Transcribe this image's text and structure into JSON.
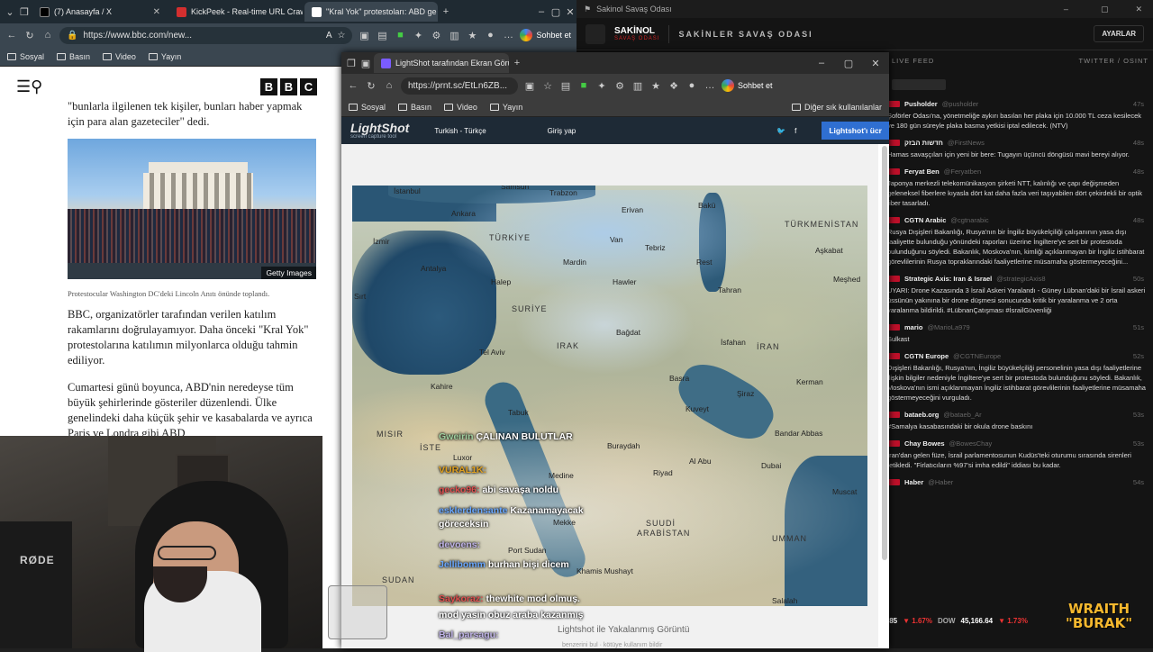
{
  "left_browser": {
    "tabs": [
      {
        "label": "(7) Anasayfa / X",
        "color": "#000000"
      },
      {
        "label": "KickPeek - Real-time URL Crawl",
        "color": "#d32f2f"
      },
      {
        "label": "\"Kral Yok\" protestoları: ABD ge",
        "color": "#111111"
      }
    ],
    "url": "https://www.bbc.com/new...",
    "sohbet": "Sohbet et",
    "bookmarks": [
      "Sosyal",
      "Basın",
      "Video",
      "Yayın"
    ]
  },
  "bbc": {
    "para0": "\"bunlarla ilgilenen tek kişiler, bunları haber yapmak için para alan gazeteciler\" dedi.",
    "image_credit": "Getty Images",
    "caption": "Protestocular Washington DC'deki Lincoln Anıtı önünde toplandı.",
    "para1": "BBC, organizatörler tarafından verilen katılım rakamlarını doğrulayamıyor. Daha önceki \"Kral Yok\" protestolarına katılımın milyonlarca olduğu tahmin ediliyor.",
    "para2": "Cumartesi günü boyunca, ABD'nin neredeyse tüm büyük şehirlerinde gösteriler düzenlendi. Ülke genelindeki daha küçük şehir ve kasabalarda ve ayrıca Paris ve Londra gibi ABD"
  },
  "cam": {
    "mic": "RØDE"
  },
  "right_app": {
    "window_title": "Sakinol Savaş Odası",
    "logo": "SAKİNOL",
    "logo_sub": "SAVAŞ ODASI",
    "heading": "SAKİNLER SAVAŞ ODASI",
    "settings": "AYARLAR",
    "live_feed": "LIVE FEED",
    "sources": "TWITTER / OSINT",
    "feed": [
      {
        "who": "Pusholder",
        "handle": "@pusholder",
        "t": "47s",
        "text": "Şoförler Odası'na, yönetmeliğe aykırı basılan her plaka için 10.000 TL ceza kesilecek ve 180 gün süreyle plaka basma yetkisi iptal edilecek. (NTV)"
      },
      {
        "who": "חדשות הבזק",
        "handle": "@FirstNews",
        "t": "48s",
        "text": "Hamas savaşçıları için yeni bir bere: Tugayın üçüncü döngüsü mavi bereyi alıyor."
      },
      {
        "who": "Feryat Ben",
        "handle": "@Feryatben",
        "t": "48s",
        "text": "Japonya merkezli telekomünikasyon şirketi NTT, kalınlığı ve çapı değişmeden geleneksel fiberlere kıyasla dört kat daha fazla veri taşıyabilen dört çekirdekli bir optik fiber tasarladı."
      },
      {
        "who": "CGTN Arabic",
        "handle": "@cgtnarabic",
        "t": "48s",
        "text": "Rusya Dışişleri Bakanlığı, Rusya'nın bir İngiliz büyükelçiliği çalışanının yasa dışı faaliyette bulunduğu yönündeki raporları üzerine İngiltere'ye sert bir protestoda bulunduğunu söyledi. Bakanlık, Moskova'nın, kimliği açıklanmayan bir İngiliz istihbarat görevlilerinin Rusya topraklarındaki faaliyetlerine müsamaha göstermeyeceğini..."
      },
      {
        "who": "Strategic Axis: Iran & Israel",
        "handle": "@strategicAxis8",
        "t": "50s",
        "text": "UYARI: Drone Kazasında 3 İsrail Askeri Yaralandı - Güney Lübnan'daki bir İsrail askeri üssünün yakınına bir drone düşmesi sonucunda kritik bir yaralanma ve 2 orta yaralanma bildirildi. #LübnanÇatışması #İsrailGüvenliği"
      },
      {
        "who": "mario",
        "handle": "@MarioLa979",
        "t": "51s",
        "text": "Sulkast"
      },
      {
        "who": "CGTN Europe",
        "handle": "@CGTNEurope",
        "t": "52s",
        "text": "Dışişleri Bakanlığı, Rusya'nın, İngiliz büyükelçiliği personelinin yasa dışı faaliyetlerine ilişkin bilgiler nedeniyle İngiltere'ye sert bir protestoda bulunduğunu söyledi. Bakanlık, Moskova'nın ismi açıklanmayan İngiliz istihbarat görevlilerinin faaliyetlerine müsamaha göstermeyeceğini vurguladı."
      },
      {
        "who": "bataeb.org",
        "handle": "@bataeb_Ar",
        "t": "53s",
        "text": "#Samalya kasabasındaki bir okula drone baskını"
      },
      {
        "who": "Chay Bowes",
        "handle": "@BowesChay",
        "t": "53s",
        "text": "İran'dan gelen füze, İsrail parlamentosunun Kudüs'teki oturumu sırasında sirenleri tetikledi. \"Firlatıcıların %97'si imha edildi\" iddiası bu kadar."
      },
      {
        "who": "Haber",
        "handle": "@Haber",
        "t": "54s",
        "text": ""
      }
    ],
    "ticker": [
      ".85",
      "▼ 1.67%",
      "DOW",
      "45,166.64",
      "▼ 1.73%"
    ],
    "overlay": [
      "WRAITH",
      "\"BURAK\""
    ]
  },
  "lightshot_window": {
    "tab": "LightShot tarafından Ekran Görünt",
    "url": "https://prnt.sc/EtLn6ZB...",
    "sohbet": "Sohbet et",
    "bookmarks": [
      "Sosyal",
      "Basın",
      "Video",
      "Yayın"
    ],
    "other_bookmarks": "Diğer sık kullanılanlar",
    "ls_logo": "LightShot",
    "ls_tag": "screen capture tool",
    "lang": "Turkish - Türkçe",
    "login": "Giriş yap",
    "install": "Lightshot'ı ücr",
    "footer": "Lightshot ile Yakalanmış Görüntü",
    "footer2": "benzerini bul  ·  kötüye kullanım bildir"
  },
  "map": {
    "cities": [
      [
        "İstanbul",
        437,
        212
      ],
      [
        "Samsun",
        556,
        207
      ],
      [
        "Trabzon",
        610,
        214
      ],
      [
        "Erivan",
        690,
        233
      ],
      [
        "Bakü",
        775,
        228
      ],
      [
        "Ankara",
        501,
        237
      ],
      [
        "İzmir",
        414,
        268
      ],
      [
        "Van",
        677,
        266
      ],
      [
        "Tebriz",
        716,
        275
      ],
      [
        "Antalya",
        467,
        298
      ],
      [
        "Halep",
        545,
        313
      ],
      [
        "Mardin",
        625,
        291
      ],
      [
        "Hawler",
        680,
        313
      ],
      [
        "Rest",
        773,
        291
      ],
      [
        "Tahran",
        797,
        322
      ],
      [
        "Meşhed",
        925,
        310
      ],
      [
        "Aşkabat",
        905,
        278
      ],
      [
        "Bağdat",
        684,
        369
      ],
      [
        "İsfahan",
        800,
        380
      ],
      [
        "Tel Aviv",
        532,
        391
      ],
      [
        "Kahire",
        478,
        429
      ],
      [
        "Basra",
        743,
        420
      ],
      [
        "Şiraz",
        818,
        437
      ],
      [
        "Kerman",
        884,
        424
      ],
      [
        "Kuveyt",
        761,
        454
      ],
      [
        "Tabuk",
        564,
        458
      ],
      [
        "Bandar Abbas",
        860,
        481
      ],
      [
        "Luxor",
        503,
        508
      ],
      [
        "Buraydah",
        674,
        495
      ],
      [
        "Dubai",
        845,
        517
      ],
      [
        "Medine",
        609,
        528
      ],
      [
        "Riyad",
        725,
        525
      ],
      [
        "Muscat",
        924,
        546
      ],
      [
        "Mekke",
        614,
        580
      ],
      [
        "Port Sudan",
        564,
        611
      ],
      [
        "Khamis Mushayt",
        640,
        634
      ],
      [
        "Al Abu",
        765,
        512
      ],
      [
        "Salalah",
        857,
        667
      ],
      [
        "Sırt",
        393,
        329
      ]
    ],
    "countries": [
      [
        "TÜRKİYE",
        563,
        264
      ],
      [
        "TÜRKMENİSTAN",
        891,
        249
      ],
      [
        "SURİYE",
        588,
        343
      ],
      [
        "IRAK",
        638,
        384
      ],
      [
        "İRAN",
        860,
        385
      ],
      [
        "MISIR",
        438,
        482
      ],
      [
        "SUUDİ",
        737,
        581
      ],
      [
        "ARABİSTAN",
        727,
        592
      ],
      [
        "UMMAN",
        877,
        598
      ],
      [
        "SUDAN",
        444,
        644
      ],
      [
        "İSTE",
        486,
        497
      ]
    ]
  },
  "chat": [
    {
      "u": "Gweirin",
      "m": "ÇALINAN BULUTLAR",
      "color": "#a0d0a0"
    },
    {
      "u": "VURAL1K:",
      "m": "",
      "color": "#e0a020"
    },
    {
      "u": "gecko96:",
      "m": "abi savaşa noldu",
      "color": "#e05050"
    },
    {
      "u": "esklerdensante",
      "m": "Kazanamayacak göreceksin",
      "color": "#6aa8ff"
    },
    {
      "u": "devoens:",
      "m": "",
      "color": "#c0b4e8"
    },
    {
      "u": "Jellibomm",
      "m": "burhan bişi dicem",
      "color": "#6aa8ff"
    },
    {
      "u": "Saykoraz:",
      "m": "thewhite mod olmuş.",
      "color": "#e05050"
    },
    {
      "u": "",
      "m": "mod yasin obuz araba kazanmış",
      "color": "#ffffff"
    },
    {
      "u": "Bal_parsagu:",
      "m": "",
      "color": "#c0b4e8"
    }
  ]
}
